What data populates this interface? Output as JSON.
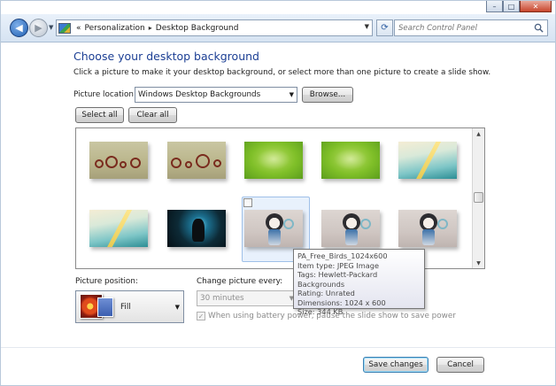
{
  "window": {
    "controls": {
      "minimize": "–",
      "maximize": "□",
      "close": "✕"
    }
  },
  "nav": {
    "back_icon": "arrow-left-icon",
    "forward_icon": "arrow-right-icon",
    "address": {
      "prefix": "«",
      "segments": [
        "Personalization",
        "Desktop Background"
      ],
      "separator": "▸"
    },
    "search_placeholder": "Search Control Panel"
  },
  "page": {
    "title": "Choose your desktop background",
    "subtitle": "Click a picture to make it your desktop background, or select more than one picture to create a slide show.",
    "location_label": "Picture location:",
    "location_value": "Windows Desktop Backgrounds",
    "browse_label": "Browse...",
    "select_all_label": "Select all",
    "clear_all_label": "Clear all"
  },
  "gallery": {
    "thumbnails": [
      {
        "style": "circles"
      },
      {
        "style": "circles"
      },
      {
        "style": "green"
      },
      {
        "style": "green"
      },
      {
        "style": "sea"
      },
      {
        "style": "sea"
      },
      {
        "style": "dark"
      },
      {
        "style": "birds",
        "selected": true
      },
      {
        "style": "birds"
      },
      {
        "style": "birds"
      }
    ]
  },
  "tooltip": {
    "lines": [
      "PA_Free_Birds_1024x600",
      "Item type: JPEG Image",
      "Tags: Hewlett-Packard Backgrounds",
      "Rating: Unrated",
      "Dimensions: 1024 x 600",
      "Size: 344 KB"
    ]
  },
  "options": {
    "position_label": "Picture position:",
    "position_value": "Fill",
    "change_label": "Change picture every:",
    "change_value": "30 minutes",
    "battery_label": "When using battery power, pause the slide show to save power",
    "battery_checked": true
  },
  "footer": {
    "save_label": "Save changes",
    "cancel_label": "Cancel"
  }
}
